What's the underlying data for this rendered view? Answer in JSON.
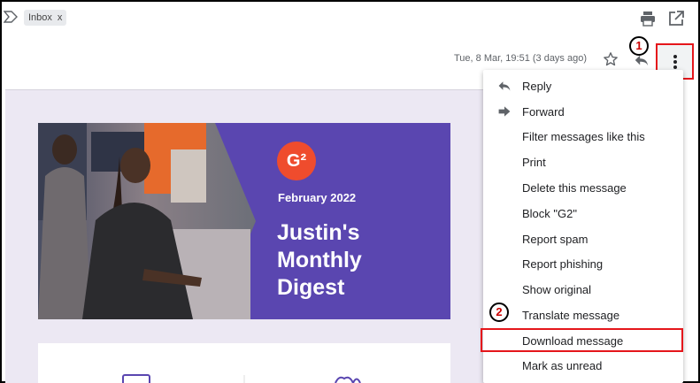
{
  "toolbar": {
    "label_chip": "Inbox",
    "chip_remove": "x",
    "icons": [
      "label-arrow-icon",
      "print-icon",
      "open-in-new-window-icon"
    ]
  },
  "message_header": {
    "date": "Tue, 8 Mar, 19:51 (3 days ago)",
    "icons": [
      "star-icon",
      "reply-icon",
      "more-vert-icon"
    ]
  },
  "annotations": {
    "step1": "1",
    "step2": "2",
    "highlight_color": "#e5161b"
  },
  "email": {
    "logo_text": "G²",
    "banner_date": "February 2022",
    "banner_title": "Justin's Monthly Digest",
    "brand_purple": "#5a46b0",
    "logo_color": "#ef4c2d"
  },
  "menu": {
    "items": [
      {
        "label": "Reply",
        "icon": "reply-icon"
      },
      {
        "label": "Forward",
        "icon": "forward-icon"
      },
      {
        "label": "Filter messages like this"
      },
      {
        "label": "Print"
      },
      {
        "label": "Delete this message"
      },
      {
        "label": "Block \"G2\""
      },
      {
        "label": "Report spam"
      },
      {
        "label": "Report phishing"
      },
      {
        "label": "Show original"
      },
      {
        "label": "Translate message"
      },
      {
        "label": "Download message"
      },
      {
        "label": "Mark as unread"
      }
    ]
  }
}
